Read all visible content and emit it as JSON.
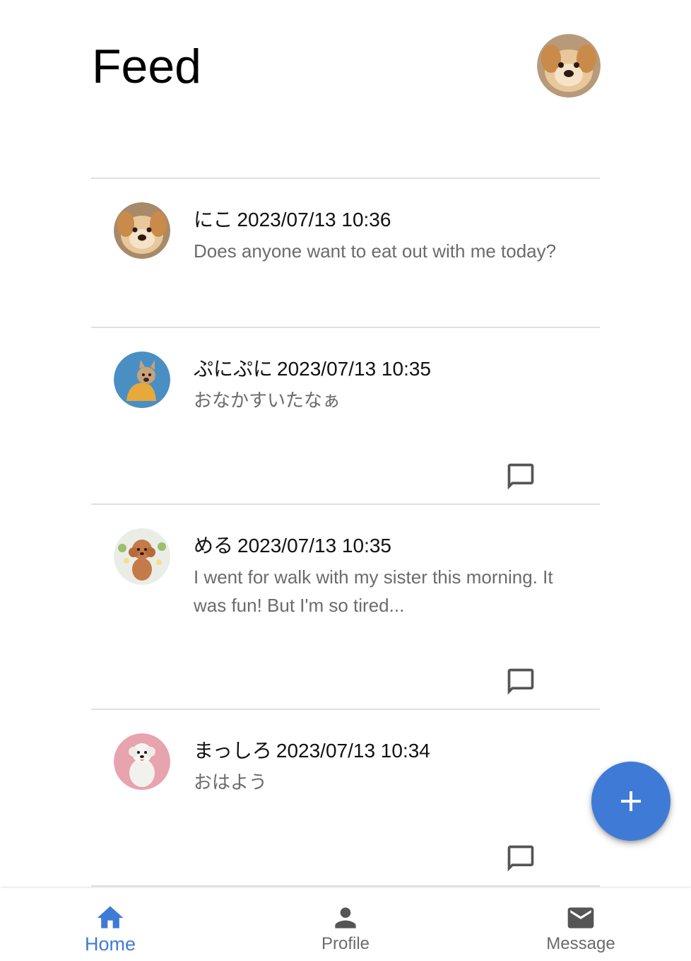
{
  "header": {
    "title": "Feed",
    "avatar_icon": "dog-avatar"
  },
  "posts": [
    {
      "name": "にこ",
      "timestamp": "2023/07/13 10:36",
      "text": "Does anyone want to eat out with me today?",
      "avatar": "golden-retriever-avatar",
      "has_comment_button": false
    },
    {
      "name": "ぷにぷに",
      "timestamp": "2023/07/13 10:35",
      "text": "おなかすいたなぁ",
      "avatar": "french-bulldog-avatar",
      "has_comment_button": true
    },
    {
      "name": "める",
      "timestamp": "2023/07/13 10:35",
      "text": "I went for walk with my sister this morning. It was fun! But I'm so tired...",
      "avatar": "toy-poodle-avatar",
      "has_comment_button": true
    },
    {
      "name": "まっしろ",
      "timestamp": "2023/07/13 10:34",
      "text": "おはよう",
      "avatar": "white-dog-avatar",
      "has_comment_button": true
    }
  ],
  "fab": {
    "icon": "plus-icon"
  },
  "bottom_nav": {
    "items": [
      {
        "label": "Home",
        "icon": "home-icon",
        "active": true
      },
      {
        "label": "Profile",
        "icon": "person-icon",
        "active": false
      },
      {
        "label": "Message",
        "icon": "mail-icon",
        "active": false
      }
    ]
  },
  "colors": {
    "accent": "#3f7bd6",
    "divider": "#e0e0e0",
    "secondary_text": "#6b6b6b",
    "icon_gray": "#555555"
  }
}
